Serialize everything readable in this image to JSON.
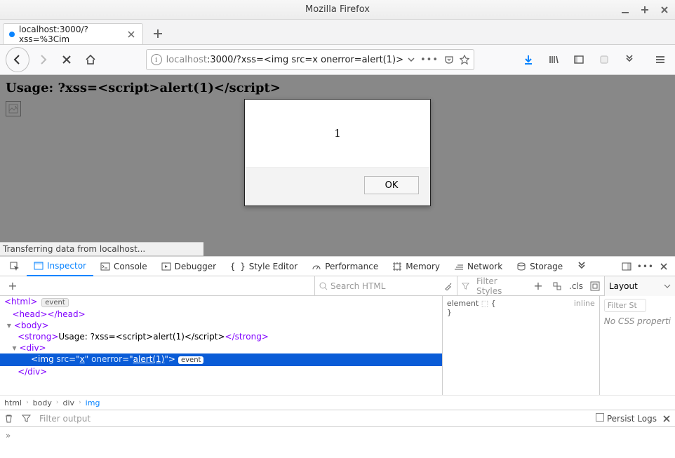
{
  "titlebar": {
    "text": "Mozilla Firefox"
  },
  "tab": {
    "title": "localhost:3000/?xss=%3Cim"
  },
  "address": {
    "host_grey": "localhost",
    "host_rest": ":3000/?xss=<img src=x onerror=alert(1)>"
  },
  "page": {
    "usage": "Usage: ?xss=<script>alert(1)</script>"
  },
  "alert": {
    "message": "1",
    "ok": "OK"
  },
  "status": {
    "text": "Transferring data from localhost..."
  },
  "devtools": {
    "tabs": {
      "inspector": "Inspector",
      "console": "Console",
      "debugger": "Debugger",
      "style_editor": "Style Editor",
      "performance": "Performance",
      "memory": "Memory",
      "network": "Network",
      "storage": "Storage"
    },
    "search_placeholder": "Search HTML",
    "filter_styles_placeholder": "Filter Styles",
    "cls": ".cls",
    "layout_label": "Layout",
    "right_filter_placeholder": "Filter St",
    "nocss": "No CSS properti",
    "dom": {
      "l1_a": "<html>",
      "l1_ev": "event",
      "l2": "<head></head>",
      "l3": "<body>",
      "l4_open": "<strong>",
      "l4_text": "Usage: ?xss=<script>alert(1)</script>",
      "l4_close": "</strong>",
      "l5": "<div>",
      "sel_open": "<img ",
      "sel_a1n": "src",
      "sel_a1v": "x",
      "sel_a2n": "onerror",
      "sel_a2v": "alert(1)",
      "sel_close": ">",
      "sel_ev": "event",
      "l7": "</div>"
    },
    "rules": {
      "element": "element",
      "brace_open": "{",
      "brace_close": "}",
      "inline": "inline"
    },
    "breadcrumbs": {
      "b1": "html",
      "b2": "body",
      "b3": "div",
      "b4": "img"
    },
    "console": {
      "filter_placeholder": "Filter output",
      "persist": "Persist Logs",
      "prompt": "»"
    }
  }
}
